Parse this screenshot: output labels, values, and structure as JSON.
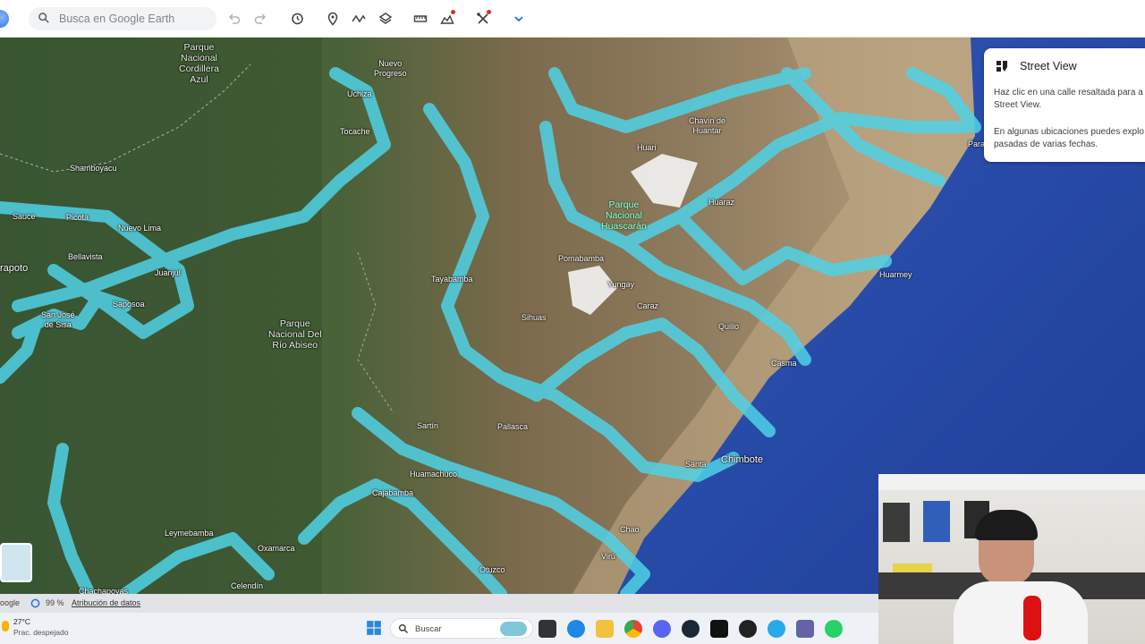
{
  "toolbar": {
    "search_placeholder": "Busca en Google Earth",
    "icons": [
      "search-icon",
      "undo-icon",
      "redo-icon",
      "history-icon",
      "placemark-icon",
      "path-icon",
      "layers-icon",
      "ruler-icon",
      "add-project-icon",
      "tools-icon",
      "chevron-down-icon"
    ]
  },
  "street_view_panel": {
    "title": "Street View",
    "text1": "Haz clic en una calle resaltada para a\nStreet View.",
    "text2": "En algunas ubicaciones puedes explo\npasadas de varias fechas."
  },
  "map": {
    "roads_color": "#4fd2e6",
    "labels": {
      "nuevo_progreso": "Nuevo\nProgreso",
      "uchiza": "Uchiza",
      "tocache": "Tocache",
      "shamboyacu": "Shamboyacu",
      "sauce": "Sauce",
      "picota": "Picota",
      "nuevo_lima": "Nuevo Lima",
      "bellavista": "Bellavista",
      "juanjui": "Juanjuí",
      "tarapoto": "rapoto",
      "saposoa": "Saposoa",
      "san_jose": "San José\nde Sisa",
      "chavin": "Chavín de\nHuantar",
      "huari": "Huari",
      "huaraz": "Huaraz",
      "pomabamba": "Pomabamba",
      "yungay": "Yungay",
      "caraz": "Caraz",
      "tayabamba": "Tayabamba",
      "sihuas": "Sihuas",
      "quillo": "Quillo",
      "casma": "Casma",
      "huarmey": "Huarmey",
      "para": "Para",
      "sartin": "Sartín",
      "pallasca": "Pallasca",
      "huamachuco": "Huamachuco",
      "cajabamba": "Cajabamba",
      "santa": "Santa",
      "chimbote": "Chimbote",
      "chao": "Chao",
      "viru": "Virú",
      "otuzco": "Otuzco",
      "leymebamba": "Leymebamba",
      "oxamarca": "Oxamarca",
      "celendin": "Celendín",
      "chachapoyas": "Chachapoyas"
    },
    "parks": {
      "cordillera_azul": "Parque\nNacional\nCordillera\nAzul",
      "huascaran": "Parque\nNacional\nHuascarán",
      "rio_abiseo": "Parque\nNacional Del\nRío Abiseo"
    }
  },
  "attribution": {
    "google": "oogle",
    "percent": "99 %",
    "link": "Atribución de datos"
  },
  "taskbar": {
    "weather_temp": "27°C",
    "weather_desc": "Prac. despejado",
    "search_label": "Buscar"
  }
}
